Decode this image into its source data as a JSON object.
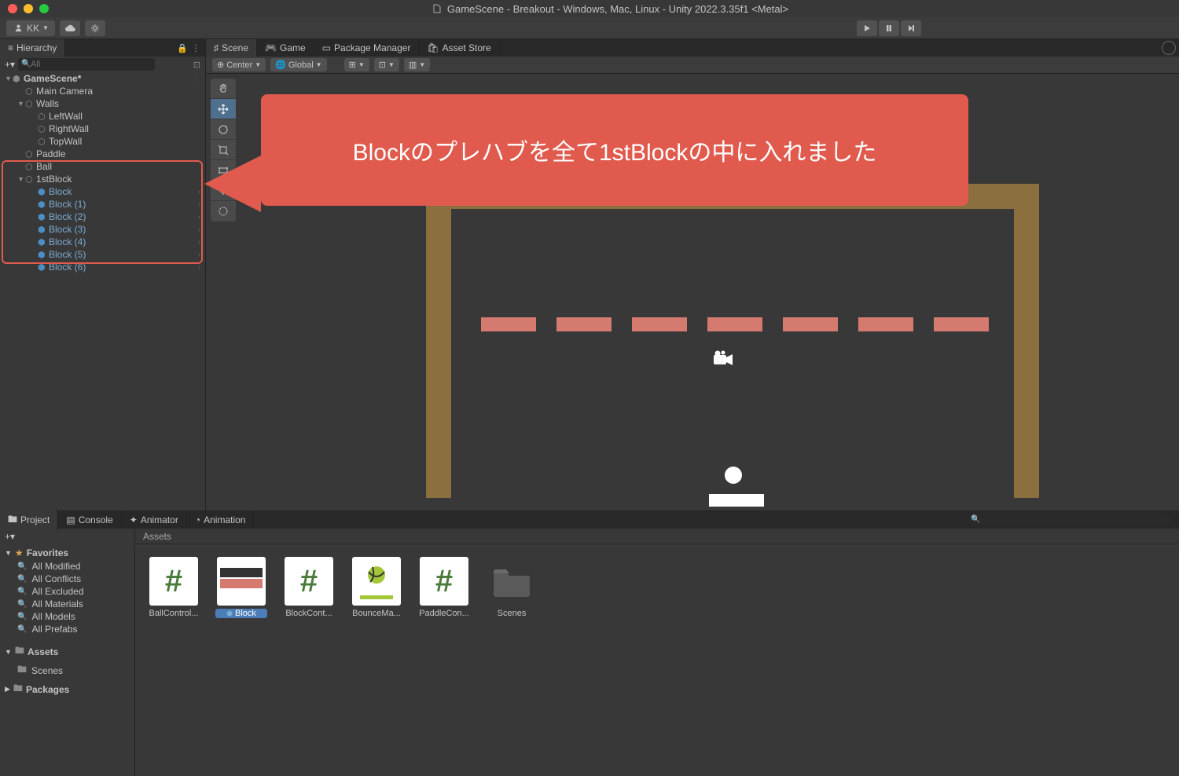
{
  "title": "GameScene - Breakout - Windows, Mac, Linux - Unity 2022.3.35f1 <Metal>",
  "account": {
    "name": "KK"
  },
  "callout_text": "Blockのプレハブを全て1stBlockの中に入れました",
  "hierarchy": {
    "tab": "Hierarchy",
    "search_placeholder": "All",
    "scene": "GameScene*",
    "items": {
      "mainCamera": "Main Camera",
      "walls": "Walls",
      "leftWall": "LeftWall",
      "rightWall": "RightWall",
      "topWall": "TopWall",
      "paddle": "Paddle",
      "ball": "Ball",
      "firstBlock": "1stBlock",
      "block": "Block",
      "block1": "Block (1)",
      "block2": "Block (2)",
      "block3": "Block (3)",
      "block4": "Block (4)",
      "block5": "Block (5)",
      "block6": "Block (6)"
    }
  },
  "sceneTabs": {
    "scene": "Scene",
    "game": "Game",
    "packageManager": "Package Manager",
    "assetStore": "Asset Store"
  },
  "sceneToolbar": {
    "pivot": "Center",
    "space": "Global"
  },
  "bottomTabs": {
    "project": "Project",
    "console": "Console",
    "animator": "Animator",
    "animation": "Animation"
  },
  "favorites": {
    "header": "Favorites",
    "allModified": "All Modified",
    "allConflicts": "All Conflicts",
    "allExcluded": "All Excluded",
    "allMaterials": "All Materials",
    "allModels": "All Models",
    "allPrefabs": "All Prefabs"
  },
  "projectTree": {
    "assets": "Assets",
    "scenes": "Scenes",
    "packages": "Packages"
  },
  "assetsPath": "Assets",
  "assets": {
    "ballCtrl": "BallControl...",
    "block": "Block",
    "blockCont": "BlockCont...",
    "bounceMa": "BounceMa...",
    "paddleCon": "PaddleCon...",
    "scenes": "Scenes"
  }
}
